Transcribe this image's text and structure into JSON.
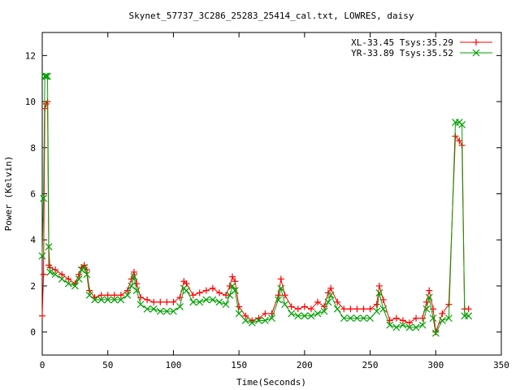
{
  "chart_data": {
    "type": "scatter",
    "title": "Skynet_57737_3C286_25283_25414_cal.txt, LOWRES, daisy",
    "xlabel": "Time(Seconds)",
    "ylabel": "Power (Kelvin)",
    "xlim": [
      0,
      350
    ],
    "ylim": [
      -1,
      13
    ],
    "xticks": [
      0,
      50,
      100,
      150,
      200,
      250,
      300,
      350
    ],
    "yticks": [
      0,
      2,
      4,
      6,
      8,
      10,
      12
    ],
    "grid": false,
    "legend_position": "top-right",
    "series": [
      {
        "name": "XL-33.45 Tsys:35.29",
        "color": "#ff0000",
        "marker": "plus",
        "x": [
          0,
          1,
          2,
          3,
          4,
          5,
          6,
          10,
          15,
          20,
          25,
          28,
          30,
          32,
          34,
          36,
          40,
          45,
          50,
          55,
          60,
          65,
          68,
          70,
          72,
          75,
          80,
          85,
          90,
          95,
          100,
          105,
          108,
          110,
          115,
          120,
          125,
          130,
          135,
          140,
          143,
          145,
          147,
          150,
          155,
          160,
          165,
          170,
          175,
          180,
          182,
          185,
          190,
          195,
          200,
          205,
          210,
          215,
          218,
          220,
          225,
          230,
          235,
          240,
          245,
          250,
          255,
          257,
          260,
          265,
          270,
          275,
          280,
          285,
          290,
          293,
          295,
          298,
          300,
          305,
          310,
          315,
          318,
          320,
          322,
          325
        ],
        "y": [
          0.7,
          2.5,
          9.7,
          9.9,
          10.0,
          2.9,
          2.8,
          2.7,
          2.5,
          2.3,
          2.1,
          2.5,
          2.8,
          2.9,
          2.7,
          1.8,
          1.5,
          1.6,
          1.6,
          1.6,
          1.6,
          1.8,
          2.3,
          2.6,
          2.1,
          1.5,
          1.4,
          1.3,
          1.3,
          1.3,
          1.3,
          1.5,
          2.2,
          2.1,
          1.6,
          1.7,
          1.8,
          1.9,
          1.7,
          1.6,
          2.0,
          2.4,
          2.2,
          1.1,
          0.7,
          0.5,
          0.6,
          0.8,
          0.8,
          1.6,
          2.3,
          1.6,
          1.1,
          1.0,
          1.1,
          1.0,
          1.3,
          1.1,
          1.7,
          1.9,
          1.3,
          1.0,
          1.0,
          1.0,
          1.0,
          1.0,
          1.2,
          2.0,
          1.4,
          0.5,
          0.6,
          0.5,
          0.4,
          0.6,
          0.6,
          1.3,
          1.8,
          1.0,
          0.0,
          0.8,
          1.2,
          8.5,
          8.3,
          8.1,
          1.0,
          1.0
        ]
      },
      {
        "name": "YR-33.89 Tsys:35.52",
        "color": "#00a000",
        "marker": "x",
        "x": [
          0,
          1,
          2,
          3,
          4,
          5,
          6,
          10,
          15,
          20,
          25,
          28,
          30,
          32,
          34,
          36,
          40,
          45,
          50,
          55,
          60,
          65,
          68,
          70,
          72,
          75,
          80,
          85,
          90,
          95,
          100,
          105,
          108,
          110,
          115,
          120,
          125,
          130,
          135,
          140,
          143,
          145,
          147,
          150,
          155,
          160,
          165,
          170,
          175,
          180,
          182,
          185,
          190,
          195,
          200,
          205,
          210,
          215,
          218,
          220,
          225,
          230,
          235,
          240,
          245,
          250,
          255,
          257,
          260,
          265,
          270,
          275,
          280,
          285,
          290,
          293,
          295,
          298,
          300,
          305,
          310,
          315,
          318,
          320,
          322,
          325
        ],
        "y": [
          3.3,
          5.8,
          11.1,
          11.1,
          11.1,
          3.7,
          2.6,
          2.5,
          2.3,
          2.1,
          2.0,
          2.3,
          2.7,
          2.8,
          2.5,
          1.6,
          1.4,
          1.4,
          1.4,
          1.4,
          1.4,
          1.6,
          2.0,
          2.4,
          1.8,
          1.2,
          1.0,
          1.0,
          0.9,
          0.9,
          0.9,
          1.1,
          1.9,
          1.8,
          1.3,
          1.3,
          1.4,
          1.4,
          1.3,
          1.2,
          1.6,
          2.0,
          1.8,
          0.8,
          0.5,
          0.4,
          0.5,
          0.5,
          0.6,
          1.4,
          1.9,
          1.2,
          0.8,
          0.7,
          0.7,
          0.7,
          0.8,
          0.9,
          1.3,
          1.6,
          1.0,
          0.6,
          0.6,
          0.6,
          0.6,
          0.6,
          0.9,
          1.7,
          1.0,
          0.3,
          0.2,
          0.3,
          0.2,
          0.2,
          0.3,
          1.0,
          1.5,
          0.6,
          -0.05,
          0.5,
          0.6,
          9.1,
          9.1,
          9.0,
          0.7,
          0.7
        ]
      }
    ]
  }
}
